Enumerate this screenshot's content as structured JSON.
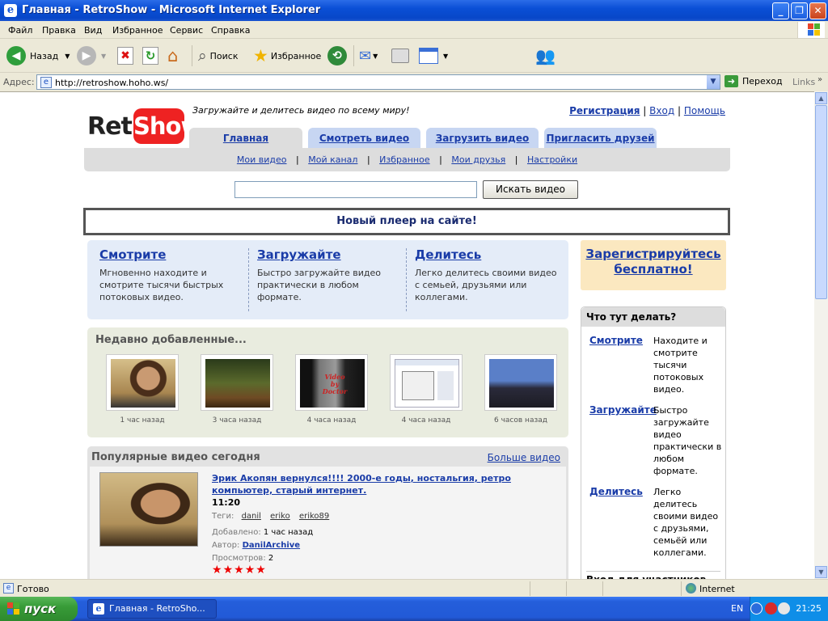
{
  "window": {
    "title": "Главная - RetroShow - Microsoft Internet Explorer"
  },
  "menu": [
    "Файл",
    "Правка",
    "Вид",
    "Избранное",
    "Сервис",
    "Справка"
  ],
  "toolbar": {
    "back": "Назад",
    "search": "Поиск",
    "favorites": "Избранное"
  },
  "address": {
    "label": "Адрес:",
    "url": "http://retroshow.hoho.ws/",
    "go": "Переход",
    "links": "Links"
  },
  "page": {
    "logo": {
      "left": "Retro",
      "right": "Show"
    },
    "tagline": "Загружайте и делитесь видео по всему миру!",
    "top_links": {
      "register": "Регистрация",
      "login": "Вход",
      "help": "Помощь"
    },
    "tabs": [
      "Главная",
      "Смотреть видео",
      "Загрузить видео",
      "Пригласить друзей"
    ],
    "subnav": [
      "Мои видео",
      "Мой канал",
      "Избранное",
      "Мои друзья",
      "Настройки"
    ],
    "search_button": "Искать видео",
    "notice": "Новый плеер на сайте!",
    "features": [
      {
        "title": "Смотрите",
        "desc": "Мгновенно находите и смотрите тысячи быстрых потоковых видео."
      },
      {
        "title": "Загружайте",
        "desc": "Быстро загружайте видео практически в любом формате."
      },
      {
        "title": "Делитесь",
        "desc": "Легко делитесь своими видео с семьей, друзьями или коллегами."
      }
    ],
    "register_promo": "Зарегистрируйтесь бесплатно!",
    "recent": {
      "title": "Недавно добавленные...",
      "items": [
        {
          "time": "1 час назад"
        },
        {
          "time": "3 часа назад"
        },
        {
          "time": "4 часа назад",
          "caption": "Video by Doctor"
        },
        {
          "time": "4 часа назад"
        },
        {
          "time": "6 часов назад"
        }
      ]
    },
    "popular": {
      "title": "Популярные видео сегодня",
      "more": "Больше видео",
      "video": {
        "title": "Эрик Акопян вернулся!!!! 2000-е годы, ностальгия, ретро компьютер, старый интернет.",
        "duration": "11:20",
        "tags_label": "Теги:",
        "tags": [
          "danil",
          "eriko",
          "eriko89"
        ],
        "added_label": "Добавлено:",
        "added": "1 час назад",
        "author_label": "Автор:",
        "author": "DanilArchive",
        "views_label": "Просмотров:",
        "views": "2",
        "rating_stars": 5
      }
    },
    "whatdo": {
      "title": "Что тут делать?",
      "items": [
        {
          "link": "Смотрите",
          "desc": "Находите и смотрите тысячи потоковых видео."
        },
        {
          "link": "Загружайте",
          "desc": "Быстро загружайте видео практически в любом формате."
        },
        {
          "link": "Делитесь",
          "desc": "Легко делитесь своими видео с друзьями, семьёй или коллегами."
        }
      ],
      "members_partial": "Вход для участников"
    }
  },
  "status": {
    "text": "Готово",
    "zone": "Internet"
  },
  "taskbar": {
    "start": "пуск",
    "task": "Главная - RetroSho...",
    "lang": "EN",
    "clock": "21:25"
  }
}
